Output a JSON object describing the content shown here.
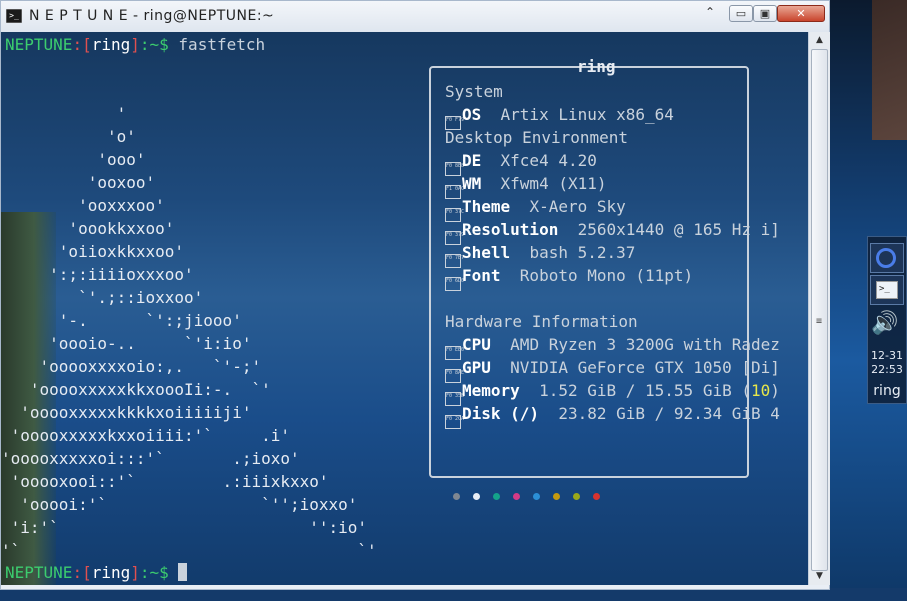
{
  "window": {
    "title": "N E P T U N E - ring@NEPTUNE:~",
    "icon": "terminal-icon",
    "buttons": {
      "rollup": "⌃",
      "minimize": "▭",
      "maximize": "▣",
      "close": "✕"
    }
  },
  "terminal": {
    "prompt": {
      "host": "NEPTUNE",
      "open": ":[",
      "user": "ring",
      "close": "]",
      "path": ":~$"
    },
    "command": "fastfetch",
    "logo": [
      "            '",
      "           'o'",
      "          'ooo'",
      "         'ooxoo'",
      "        'ooxxxoo'",
      "       'oookkxxoo'",
      "      'oiioxkkxxoo'",
      "     ':;:iiiioxxxoo'",
      "        `'.;::ioxxoo'",
      "      '-.      `':;jiooo'",
      "     'oooio-..     `'i:io'",
      "    'ooooxxxxoio:,.   `'-;'",
      "   'ooooxxxxxkkxoooIi:-.  `'",
      "  'ooooxxxxxkkkkxoiiiiiji'",
      " 'ooooxxxxxkxxoiiii:'`     .i'",
      "'ooooxxxxxoi:::'`       .;ioxo'",
      " 'ooooxooi::'`         .:iiixkxxo'",
      "  'ooooi:'`                `'';ioxxo'",
      " 'i:'`                          '':io'",
      "'`                                   `'"
    ],
    "box_title": "ring",
    "info": {
      "system_header": "System",
      "os": {
        "icon": "F0 F79",
        "key": "OS",
        "value": "Artix Linux x86_64"
      },
      "desktop_header": "Desktop Environment",
      "de": {
        "icon": "F0 8E8",
        "key": "DE",
        "value": "Xfce4 4.20"
      },
      "wm": {
        "icon": "F1 0AC",
        "key": "WM",
        "value": "Xfwm4 (X11)"
      },
      "theme": {
        "icon": "F0 37C",
        "key": "Theme",
        "value": "X-Aero Sky"
      },
      "resolution": {
        "icon": "F0 379",
        "key": "Resolution",
        "value": "2560x1440 @ 165 Hz i]"
      },
      "shell": {
        "icon": "F0 7B7",
        "key": "Shell",
        "value": "bash 5.2.37"
      },
      "font": {
        "icon": "F0 6D0",
        "key": "Font",
        "value": "Roboto Mono (11pt)"
      },
      "hardware_header": "Hardware Information",
      "cpu": {
        "icon": "F0 EE0",
        "key": "CPU",
        "value": "AMD Ryzen 3 3200G with Radez"
      },
      "gpu": {
        "icon": "F0 8AE",
        "key": "GPU",
        "value": "NVIDIA GeForce GTX 1050 [Di]"
      },
      "memory": {
        "icon": "F0 35B",
        "key": "Memory",
        "value_a": "1.52 GiB / 15.55 GiB (",
        "value_hl": "10",
        "value_b": ")"
      },
      "disk": {
        "icon": "F0 2CA",
        "key": "Disk (/)",
        "value": "23.82 GiB / 92.34 GiB 4"
      }
    },
    "colors": [
      "#7f8791",
      "#e9eef5",
      "#14a38a",
      "#d53a86",
      "#2b8fd6",
      "#c49a10",
      "#9aa81a",
      "#d8332f"
    ]
  },
  "scrollbar": {
    "up": "▲",
    "down": "▼",
    "grip": "≡"
  },
  "panel": {
    "date": "12-31",
    "time": "22:53",
    "user": "ring",
    "volume": "🔊",
    "term_glyph": ">_"
  }
}
